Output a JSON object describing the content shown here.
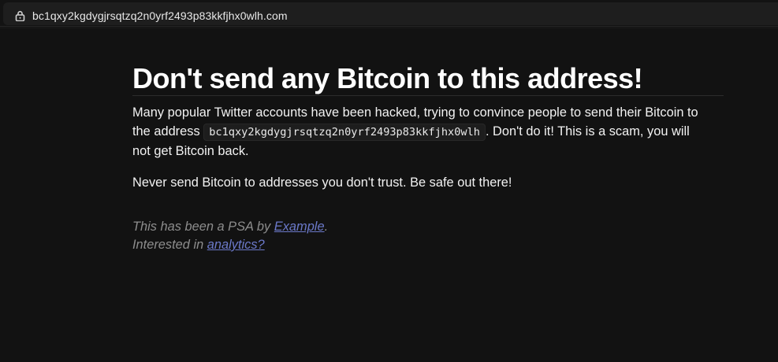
{
  "browser": {
    "url": "bc1qxy2kgdygjrsqtzq2n0yrf2493p83kkfjhx0wlh.com",
    "lock_icon": "lock-icon"
  },
  "page": {
    "heading": "Don't send any Bitcoin to this address!",
    "para1_before": "Many popular Twitter accounts have been hacked, trying to convince people to send their Bitcoin to the address ",
    "address": "bc1qxy2kgdygjrsqtzq2n0yrf2493p83kkfjhx0wlh",
    "para1_after": ". Don't do it! This is a scam, you will not get Bitcoin back.",
    "para2": "Never send Bitcoin to addresses you don't trust. Be safe out there!",
    "psa_prefix": "This has been a PSA by ",
    "psa_link": "Example",
    "psa_suffix": ".",
    "interested_prefix": "Interested in ",
    "interested_link": "analytics?"
  },
  "colors": {
    "background": "#121212",
    "text": "#f2f2f2",
    "muted": "#8d8d8d",
    "link": "#6b79c9"
  }
}
